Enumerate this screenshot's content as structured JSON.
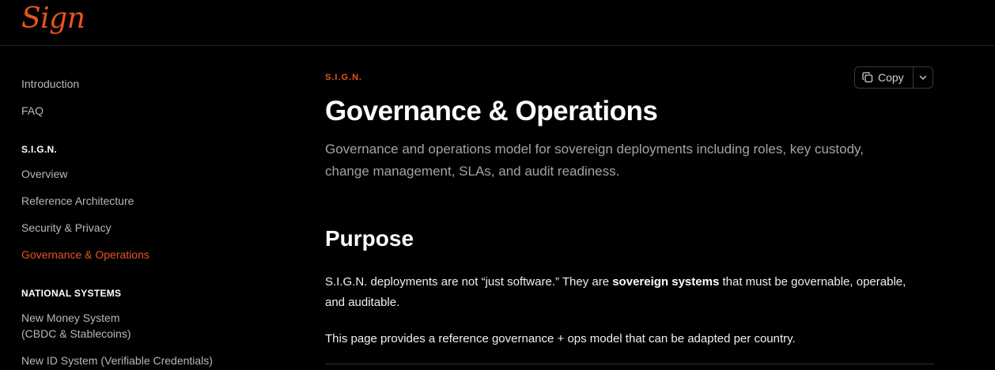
{
  "brand": {
    "logo_text": "Sign",
    "accent": "#e8551f"
  },
  "sidebar": {
    "items_top": [
      {
        "label": "Introduction"
      },
      {
        "label": "FAQ"
      }
    ],
    "section_sign": {
      "heading": "S.I.G.N.",
      "items": [
        {
          "label": "Overview"
        },
        {
          "label": "Reference Architecture"
        },
        {
          "label": "Security & Privacy"
        },
        {
          "label": "Governance & Operations",
          "active": true
        }
      ]
    },
    "section_national": {
      "heading": "NATIONAL SYSTEMS",
      "items": [
        {
          "line1": "New Money System",
          "line2": "(CBDC & Stablecoins)"
        },
        {
          "label": "New ID System (Verifiable Credentials)"
        }
      ]
    }
  },
  "main": {
    "eyebrow": "S.I.G.N.",
    "title": "Governance & Operations",
    "subtitle": "Governance and operations model for sovereign deployments including roles, key custody, change management, SLAs, and audit readiness.",
    "copy_label": "Copy",
    "purpose": {
      "heading": "Purpose",
      "para1_before": "S.I.G.N. deployments are not “just software.” They are ",
      "para1_bold": "sovereign systems",
      "para1_after": " that must be governable, operable, and auditable.",
      "para2": "This page provides a reference governance + ops model that can be adapted per country."
    }
  }
}
